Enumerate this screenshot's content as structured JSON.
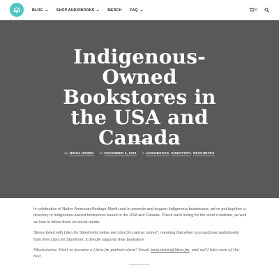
{
  "header": {
    "logo_icon": "headphones-book-icon",
    "nav": [
      {
        "label": "BLOG",
        "has_dropdown": true
      },
      {
        "label": "SHOP AUDIOBOOKS",
        "has_dropdown": true
      },
      {
        "label": "MERCH",
        "has_dropdown": false
      },
      {
        "label": "FAQ",
        "has_dropdown": true
      }
    ],
    "cart_count": "0",
    "cart_icon": "cart-icon",
    "search_icon": "search-icon"
  },
  "hero": {
    "title": "Indigenous-Owned Bookstores in the USA and Canada",
    "meta": {
      "by_label": "by",
      "author": "JENNA HOMEN",
      "on_label": "on",
      "date": "NOVEMBER 2, 2020",
      "in_label": "in",
      "categories": [
        "AUDIOBOOKS",
        "DIRECTORY",
        "RESOURCES"
      ]
    },
    "background": "#595959"
  },
  "content": {
    "p1": "In celebration of Native American Heritage Month and to promote and support Indigenous businesses, we've put together a directory of Indigenous-owned bookstores based in the USA and Canada. Check each listing for the store's website, as well as how to follow them on social media.",
    "p2": "Stores listed with Libro.fm Storefronts below are Libro.fm partner stores*, meaning that when you purchase audiobooks from their Libro.fm Storefront, it directly supports their bookstore.",
    "note_before": "*Bookstores: Want to become a Libro.fm partner store? Email ",
    "note_link": "bookstores@libro.fm",
    "note_after": ", and we'll take care of the rest."
  },
  "colors": {
    "brand": "#4dc6c2",
    "hero": "#595959"
  }
}
